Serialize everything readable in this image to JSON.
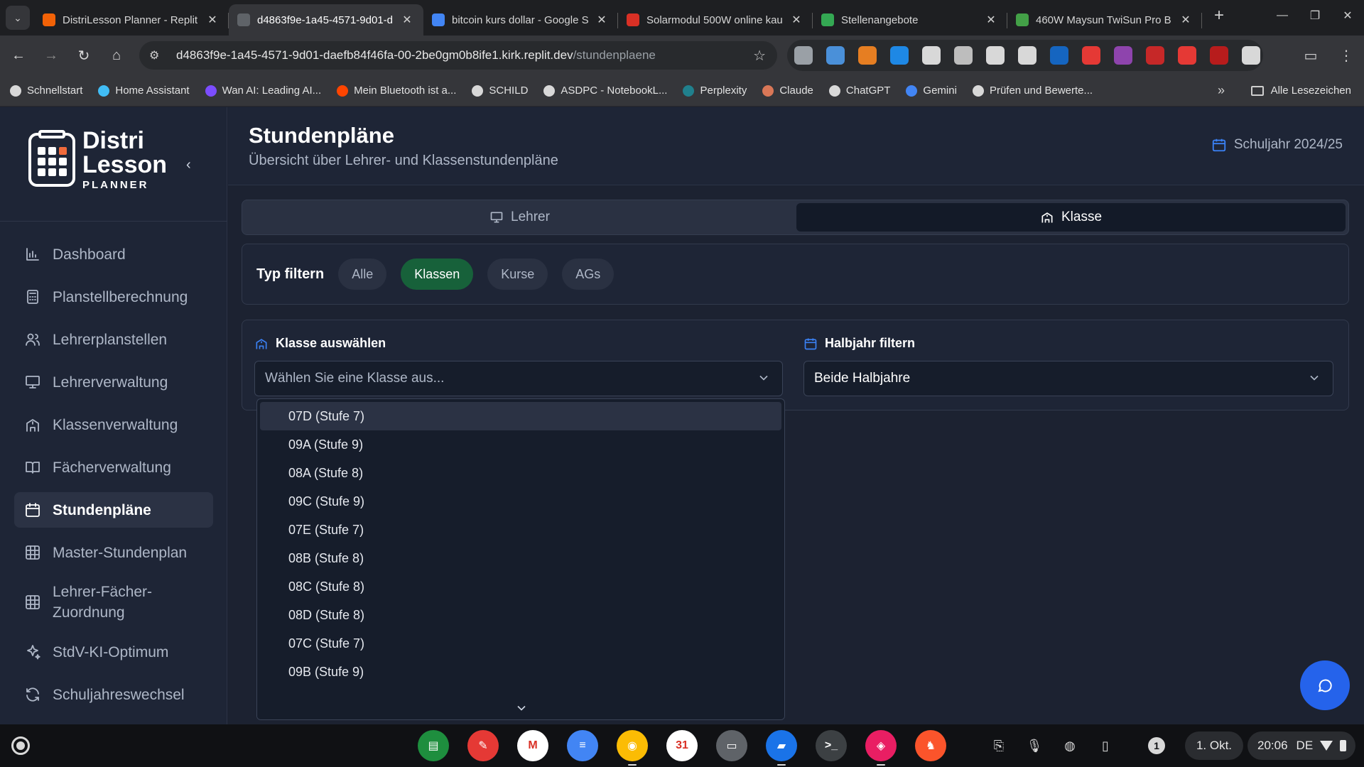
{
  "browser": {
    "tabs": [
      {
        "title": "DistriLesson Planner - Replit",
        "icon_color": "#f26207",
        "active": false
      },
      {
        "title": "d4863f9e-1a45-4571-9d01-d",
        "icon_color": "#5f6368",
        "active": true
      },
      {
        "title": "bitcoin kurs dollar - Google S",
        "icon_color": "#4285f4",
        "active": false
      },
      {
        "title": "Solarmodul 500W online kau",
        "icon_color": "#d93025",
        "active": false
      },
      {
        "title": "Stellenangebote",
        "icon_color": "#34a853",
        "active": false
      },
      {
        "title": "460W Maysun TwiSun Pro B",
        "icon_color": "#43a047",
        "active": false
      }
    ],
    "tab_close_glyph": "✕",
    "new_tab_glyph": "+",
    "url_host": "d4863f9e-1a45-4571-9d01-daefb84f46fa-00-2be0gm0b8ife1.kirk.replit.dev",
    "url_path": "/stundenplaene",
    "extension_colors": [
      "#9aa0a6",
      "#4a90d9",
      "#e67e22",
      "#1e88e5",
      "#d8d8d8",
      "#bdbdbd",
      "#d8d8d8",
      "#d8d8d8",
      "#1565c0",
      "#e53935",
      "#8e44ad",
      "#c62828",
      "#e53935",
      "#b71c1c",
      "#d8d8d8"
    ],
    "bookmarks": [
      {
        "label": "Schnellstart",
        "color": "#d8d8d8"
      },
      {
        "label": "Home Assistant",
        "color": "#41bdf5"
      },
      {
        "label": "Wan AI: Leading AI...",
        "color": "#7c4dff"
      },
      {
        "label": "Mein Bluetooth ist a...",
        "color": "#ff4500"
      },
      {
        "label": "SCHILD",
        "color": "#d8d8d8"
      },
      {
        "label": "ASDPC - NotebookL...",
        "color": "#d8d8d8"
      },
      {
        "label": "Perplexity",
        "color": "#20808d"
      },
      {
        "label": "Claude",
        "color": "#d97757"
      },
      {
        "label": "ChatGPT",
        "color": "#d8d8d8"
      },
      {
        "label": "Gemini",
        "color": "#4285f4"
      },
      {
        "label": "Prüfen und Bewerte...",
        "color": "#d8d8d8"
      }
    ],
    "bookmarks_more": "»",
    "all_bookmarks": "Alle Lesezeichen"
  },
  "app": {
    "logo": {
      "line1": "Distri",
      "line2": "Lesson",
      "line3": "PLANNER"
    },
    "nav": [
      {
        "label": "Dashboard",
        "icon": "bar-chart-icon",
        "active": false
      },
      {
        "label": "Planstellberechnung",
        "icon": "calculator-icon",
        "active": false
      },
      {
        "label": "Lehrerplanstellen",
        "icon": "users-icon",
        "active": false
      },
      {
        "label": "Lehrerverwaltung",
        "icon": "presentation-icon",
        "active": false
      },
      {
        "label": "Klassenverwaltung",
        "icon": "school-icon",
        "active": false
      },
      {
        "label": "Fächerverwaltung",
        "icon": "book-icon",
        "active": false
      },
      {
        "label": "Stundenpläne",
        "icon": "calendar-icon",
        "active": true
      },
      {
        "label": "Master-Stundenplan",
        "icon": "grid-icon",
        "active": false
      },
      {
        "label": "Lehrer-Fächer-Zuordnung",
        "line1": "Lehrer-Fächer-",
        "line2": "Zuordnung",
        "icon": "grid-icon",
        "active": false
      },
      {
        "label": "StdV-KI-Optimum",
        "icon": "sparkles-icon",
        "active": false
      },
      {
        "label": "Schuljahreswechsel",
        "icon": "refresh-icon",
        "active": false
      }
    ],
    "header": {
      "title": "Stundenpläne",
      "subtitle": "Übersicht über Lehrer- und Klassenstundenpläne",
      "school_year": "Schuljahr 2024/25"
    },
    "view_toggle": {
      "teacher": "Lehrer",
      "class": "Klasse",
      "selected": "Klasse"
    },
    "type_filter": {
      "label": "Typ filtern",
      "options": [
        "Alle",
        "Klassen",
        "Kurse",
        "AGs"
      ],
      "selected": "Klassen"
    },
    "class_select": {
      "label": "Klasse auswählen",
      "placeholder": "Wählen Sie eine Klasse aus...",
      "options": [
        "07D (Stufe 7)",
        "09A (Stufe 9)",
        "08A (Stufe 8)",
        "09C (Stufe 9)",
        "07E (Stufe 7)",
        "08B (Stufe 8)",
        "08C (Stufe 8)",
        "08D (Stufe 8)",
        "07C (Stufe 7)",
        "09B (Stufe 9)"
      ],
      "highlighted": "07D (Stufe 7)"
    },
    "half_year_select": {
      "label": "Halbjahr filtern",
      "value": "Beide Halbjahre"
    },
    "accent": "#3b82f6",
    "active_chip_color": "#17613a"
  },
  "shelf": {
    "apps": [
      {
        "name": "classroom",
        "color": "#1e8e3e",
        "glyph": "▤"
      },
      {
        "name": "canvas",
        "color": "#e53935",
        "glyph": "✎"
      },
      {
        "name": "gmail",
        "color": "#ffffff",
        "glyph": "M"
      },
      {
        "name": "docs",
        "color": "#4285f4",
        "glyph": "≡"
      },
      {
        "name": "chrome",
        "color": "#fbbc04",
        "glyph": "◉"
      },
      {
        "name": "calendar",
        "color": "#ffffff",
        "glyph": "31"
      },
      {
        "name": "print",
        "color": "#5f6368",
        "glyph": "▭"
      },
      {
        "name": "files",
        "color": "#1a73e8",
        "glyph": "▰"
      },
      {
        "name": "terminal",
        "color": "#3c4043",
        "glyph": ">_"
      },
      {
        "name": "app-pink",
        "color": "#e91e63",
        "glyph": "◈"
      },
      {
        "name": "brave",
        "color": "#fb542b",
        "glyph": "♞"
      }
    ],
    "notification_count": "1",
    "date": "1. Okt.",
    "time": "20:06",
    "language": "DE"
  }
}
